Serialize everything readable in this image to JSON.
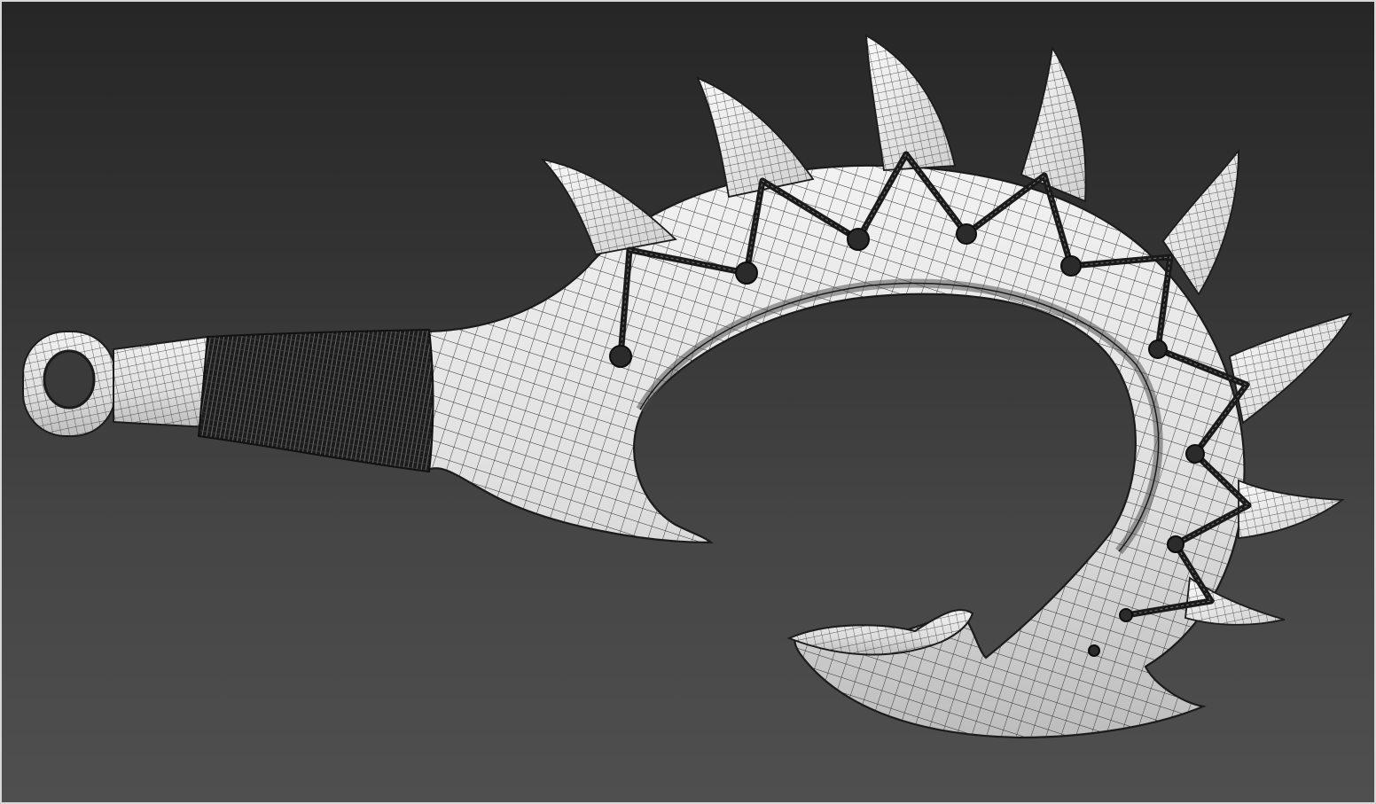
{
  "viewport": {
    "mode": "3d-viewport",
    "shading": "wireframe-on-shaded",
    "background_gradient": [
      "#262626",
      "#4f4f4f"
    ],
    "border_color": "#d8d8d8"
  },
  "model": {
    "icon": "hook-weapon-mesh",
    "surface_color": "#e4e4e4",
    "wire_color": "#1b1b1b",
    "lashing_color": "#1a1a1a",
    "parts": [
      "ring-pommel",
      "handle-collar",
      "cord-grip",
      "hooked-blade",
      "dorsal-spikes",
      "rope-lashing",
      "inner-tip"
    ]
  }
}
